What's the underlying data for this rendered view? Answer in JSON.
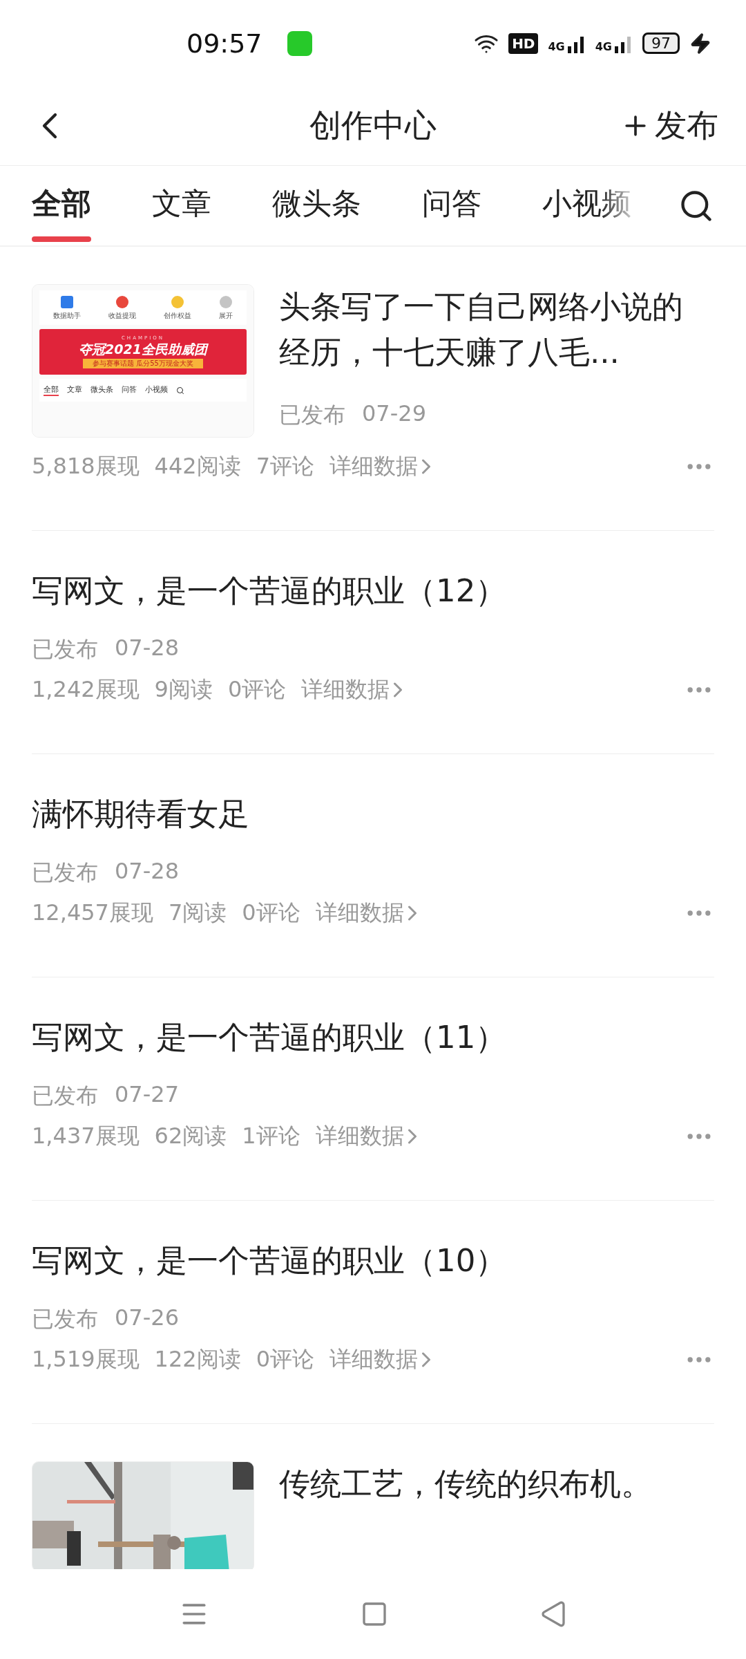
{
  "status_bar": {
    "time": "09:57",
    "hd": "HD",
    "networks": [
      "4G",
      "4G"
    ],
    "battery": "97",
    "charging": true
  },
  "header": {
    "title": "创作中心",
    "action": "发布"
  },
  "tabs": [
    {
      "label": "全部",
      "selected": true
    },
    {
      "label": "文章",
      "selected": false
    },
    {
      "label": "微头条",
      "selected": false
    },
    {
      "label": "问答",
      "selected": false
    },
    {
      "label": "小视频",
      "selected": false
    }
  ],
  "articles": [
    {
      "kind": "screenshot",
      "title": "头条写了一下自己网络小说的经历，十七天赚了八毛...",
      "status": "已发布",
      "date": "07-29",
      "views": "5,818展现",
      "reads": "442阅读",
      "comments": "7评论",
      "details": "详细数据",
      "thumbnail": {
        "shortcuts": [
          {
            "label": "数据助手",
            "color": "#2f7be8"
          },
          {
            "label": "收益提现",
            "color": "#e8473c"
          },
          {
            "label": "创作权益",
            "color": "#f4c235"
          },
          {
            "label": "展开",
            "color": "#c4c4c4"
          }
        ],
        "banner": {
          "tag": "CHAMPION",
          "headline": "夺冠2021全民助威团",
          "subline": "参与赛事话题 瓜分55万现金大奖"
        },
        "tabs": [
          {
            "label": "全部",
            "selected": true
          },
          {
            "label": "文章",
            "selected": false
          },
          {
            "label": "微头条",
            "selected": false
          },
          {
            "label": "问答",
            "selected": false
          },
          {
            "label": "小视频",
            "selected": false
          }
        ]
      }
    },
    {
      "kind": "text",
      "title": "写网文，是一个苦逼的职业（12）",
      "status": "已发布",
      "date": "07-28",
      "views": "1,242展现",
      "reads": "9阅读",
      "comments": "0评论",
      "details": "详细数据"
    },
    {
      "kind": "text",
      "title": "满怀期待看女足",
      "status": "已发布",
      "date": "07-28",
      "views": "12,457展现",
      "reads": "7阅读",
      "comments": "0评论",
      "details": "详细数据"
    },
    {
      "kind": "text",
      "title": "写网文，是一个苦逼的职业（11）",
      "status": "已发布",
      "date": "07-27",
      "views": "1,437展现",
      "reads": "62阅读",
      "comments": "1评论",
      "details": "详细数据"
    },
    {
      "kind": "text",
      "title": "写网文，是一个苦逼的职业（10）",
      "status": "已发布",
      "date": "07-26",
      "views": "1,519展现",
      "reads": "122阅读",
      "comments": "0评论",
      "details": "详细数据"
    },
    {
      "kind": "picture",
      "title": "传统工艺，传统的织布机。"
    }
  ]
}
